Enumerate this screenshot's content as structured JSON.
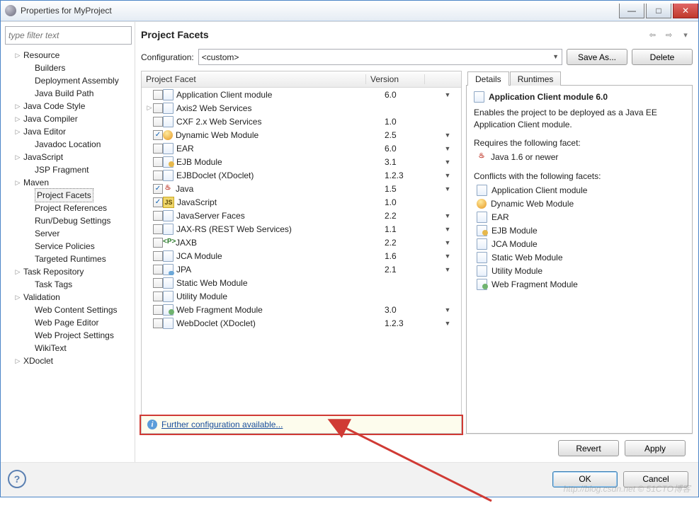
{
  "window": {
    "title": "Properties for MyProject"
  },
  "sidebar": {
    "filter_placeholder": "type filter text",
    "items": [
      {
        "label": "Resource",
        "depth": 1,
        "twist": "▷"
      },
      {
        "label": "Builders",
        "depth": 2,
        "twist": ""
      },
      {
        "label": "Deployment Assembly",
        "depth": 2,
        "twist": ""
      },
      {
        "label": "Java Build Path",
        "depth": 2,
        "twist": ""
      },
      {
        "label": "Java Code Style",
        "depth": 1,
        "twist": "▷"
      },
      {
        "label": "Java Compiler",
        "depth": 1,
        "twist": "▷"
      },
      {
        "label": "Java Editor",
        "depth": 1,
        "twist": "▷"
      },
      {
        "label": "Javadoc Location",
        "depth": 2,
        "twist": ""
      },
      {
        "label": "JavaScript",
        "depth": 1,
        "twist": "▷"
      },
      {
        "label": "JSP Fragment",
        "depth": 2,
        "twist": ""
      },
      {
        "label": "Maven",
        "depth": 1,
        "twist": "▷"
      },
      {
        "label": "Project Facets",
        "depth": 2,
        "twist": "",
        "selected": true
      },
      {
        "label": "Project References",
        "depth": 2,
        "twist": ""
      },
      {
        "label": "Run/Debug Settings",
        "depth": 2,
        "twist": ""
      },
      {
        "label": "Server",
        "depth": 2,
        "twist": ""
      },
      {
        "label": "Service Policies",
        "depth": 2,
        "twist": ""
      },
      {
        "label": "Targeted Runtimes",
        "depth": 2,
        "twist": ""
      },
      {
        "label": "Task Repository",
        "depth": 1,
        "twist": "▷"
      },
      {
        "label": "Task Tags",
        "depth": 2,
        "twist": ""
      },
      {
        "label": "Validation",
        "depth": 1,
        "twist": "▷"
      },
      {
        "label": "Web Content Settings",
        "depth": 2,
        "twist": ""
      },
      {
        "label": "Web Page Editor",
        "depth": 2,
        "twist": ""
      },
      {
        "label": "Web Project Settings",
        "depth": 2,
        "twist": ""
      },
      {
        "label": "WikiText",
        "depth": 2,
        "twist": ""
      },
      {
        "label": "XDoclet",
        "depth": 1,
        "twist": "▷"
      }
    ]
  },
  "main": {
    "heading": "Project Facets",
    "config_label": "Configuration:",
    "config_value": "<custom>",
    "save_as": "Save As...",
    "delete": "Delete",
    "columns": {
      "facet": "Project Facet",
      "version": "Version"
    }
  },
  "facets": [
    {
      "checked": false,
      "twist": "",
      "icon": "file",
      "name": "Application Client module",
      "version": "6.0",
      "arrow": true
    },
    {
      "checked": false,
      "twist": "▷",
      "icon": "file",
      "name": "Axis2 Web Services",
      "version": "",
      "arrow": false
    },
    {
      "checked": false,
      "twist": "",
      "icon": "file",
      "name": "CXF 2.x Web Services",
      "version": "1.0",
      "arrow": false
    },
    {
      "checked": true,
      "twist": "",
      "icon": "dwm",
      "name": "Dynamic Web Module",
      "version": "2.5",
      "arrow": true
    },
    {
      "checked": false,
      "twist": "",
      "icon": "file",
      "name": "EAR",
      "version": "6.0",
      "arrow": true
    },
    {
      "checked": false,
      "twist": "",
      "icon": "file-y",
      "name": "EJB Module",
      "version": "3.1",
      "arrow": true
    },
    {
      "checked": false,
      "twist": "",
      "icon": "file",
      "name": "EJBDoclet (XDoclet)",
      "version": "1.2.3",
      "arrow": true
    },
    {
      "checked": true,
      "twist": "",
      "icon": "java",
      "name": "Java",
      "version": "1.5",
      "arrow": true
    },
    {
      "checked": true,
      "twist": "",
      "icon": "js",
      "name": "JavaScript",
      "version": "1.0",
      "arrow": false
    },
    {
      "checked": false,
      "twist": "",
      "icon": "file",
      "name": "JavaServer Faces",
      "version": "2.2",
      "arrow": true
    },
    {
      "checked": false,
      "twist": "",
      "icon": "file",
      "name": "JAX-RS (REST Web Services)",
      "version": "1.1",
      "arrow": true
    },
    {
      "checked": false,
      "twist": "",
      "icon": "jaxb",
      "name": "JAXB",
      "version": "2.2",
      "arrow": true
    },
    {
      "checked": false,
      "twist": "",
      "icon": "file",
      "name": "JCA Module",
      "version": "1.6",
      "arrow": true
    },
    {
      "checked": false,
      "twist": "",
      "icon": "file-db",
      "name": "JPA",
      "version": "2.1",
      "arrow": true
    },
    {
      "checked": false,
      "twist": "",
      "icon": "file",
      "name": "Static Web Module",
      "version": "",
      "arrow": false
    },
    {
      "checked": false,
      "twist": "",
      "icon": "file",
      "name": "Utility Module",
      "version": "",
      "arrow": false
    },
    {
      "checked": false,
      "twist": "",
      "icon": "file-g",
      "name": "Web Fragment Module",
      "version": "3.0",
      "arrow": true
    },
    {
      "checked": false,
      "twist": "",
      "icon": "file",
      "name": "WebDoclet (XDoclet)",
      "version": "1.2.3",
      "arrow": true
    }
  ],
  "footer_link": "Further configuration available...",
  "details": {
    "tab_details": "Details",
    "tab_runtimes": "Runtimes",
    "title": "Application Client module 6.0",
    "description": "Enables the project to be deployed as a Java EE Application Client module.",
    "requires_label": "Requires the following facet:",
    "requires": [
      {
        "icon": "java",
        "label": "Java 1.6 or newer"
      }
    ],
    "conflicts_label": "Conflicts with the following facets:",
    "conflicts": [
      {
        "icon": "file",
        "label": "Application Client module"
      },
      {
        "icon": "dwm",
        "label": "Dynamic Web Module"
      },
      {
        "icon": "file",
        "label": "EAR"
      },
      {
        "icon": "file-y",
        "label": "EJB Module"
      },
      {
        "icon": "file",
        "label": "JCA Module"
      },
      {
        "icon": "file",
        "label": "Static Web Module"
      },
      {
        "icon": "file",
        "label": "Utility Module"
      },
      {
        "icon": "file-g",
        "label": "Web Fragment Module"
      }
    ]
  },
  "buttons": {
    "revert": "Revert",
    "apply": "Apply",
    "ok": "OK",
    "cancel": "Cancel"
  },
  "watermark": "http://blog.csdn.net   © 51CTO博客"
}
